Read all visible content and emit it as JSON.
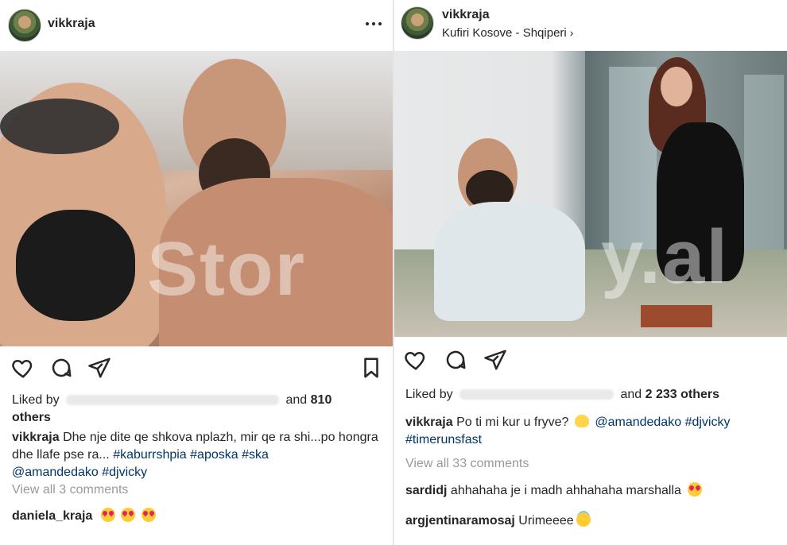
{
  "left_post": {
    "username": "vikkraja",
    "liked_by_prefix": "Liked by",
    "liked_and": "and",
    "liked_count": "810",
    "liked_others": "others",
    "caption": {
      "author": "vikkraja",
      "text": "Dhe nje dite qe shkova nplazh, mir qe ra shi...po hongra dhe llafe pse ra...",
      "tags": [
        "#kaburrshpia",
        "#aposka",
        "#ska",
        "@amandedako",
        "#djvicky"
      ]
    },
    "view_comments": "View all 3 comments",
    "comments": [
      {
        "user": "daniela_kraja",
        "emoji": [
          "heart-eyes-emoji",
          "heart-eyes-emoji",
          "heart-eyes-emoji"
        ]
      }
    ],
    "watermark": "Stor"
  },
  "right_post": {
    "username": "vikkraja",
    "location": "Kufiri Kosove - Shqiperi",
    "location_chevron": "›",
    "liked_by_prefix": "Liked by",
    "liked_and": "and",
    "liked_count": "2 233",
    "liked_others": "others",
    "caption": {
      "author": "vikkraja",
      "text": "Po ti mi kur u fryve?",
      "tags": [
        "@amandedako",
        "#djvicky",
        "#timerunsfast"
      ]
    },
    "view_comments": "View all 33 comments",
    "comments": [
      {
        "user": "sardidj",
        "text": "ahhahaha je i madh ahhahaha marshalla"
      },
      {
        "user": "argjentinaramosaj",
        "text": "Urimeeee"
      }
    ],
    "watermark": "y.al"
  },
  "colors": {
    "text": "#262626",
    "link": "#003569",
    "muted": "#999999",
    "background": "#ffffff"
  }
}
